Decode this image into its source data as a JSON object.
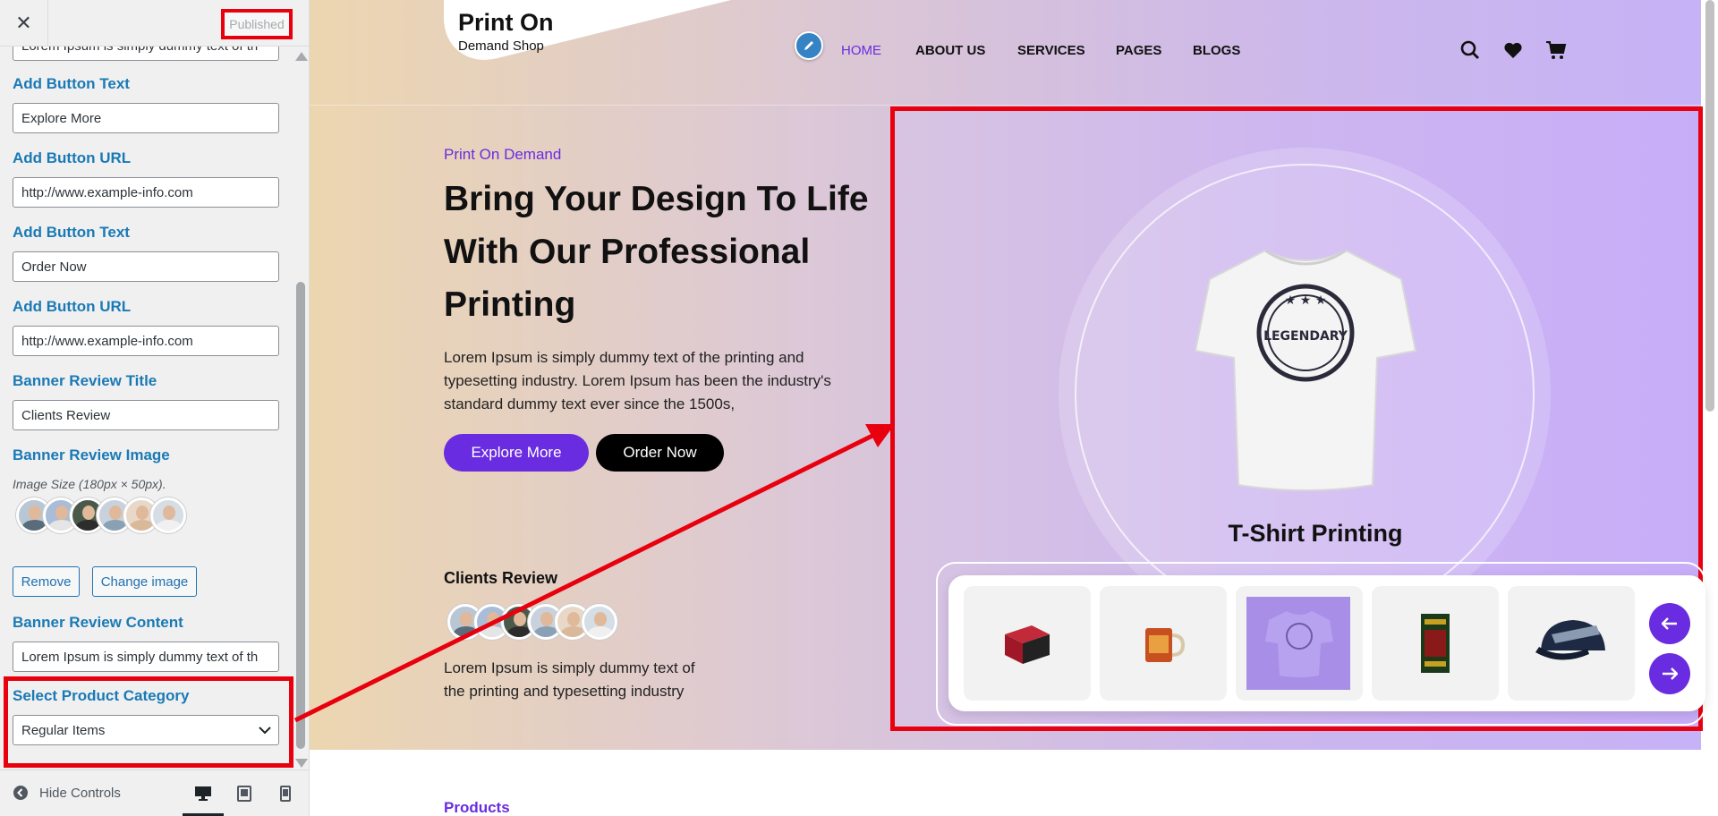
{
  "panel": {
    "close_glyph": "✕",
    "published_label": "Published",
    "top_partial_text": "Lorem Ipsum is simply dummy text of th",
    "fields": [
      {
        "label": "Add Button Text",
        "value": "Explore More"
      },
      {
        "label": "Add Button URL",
        "value": "http://www.example-info.com"
      },
      {
        "label": "Add Button Text",
        "value": "Order Now"
      },
      {
        "label": "Add Button URL",
        "value": "http://www.example-info.com"
      },
      {
        "label": "Banner Review Title",
        "value": "Clients Review"
      }
    ],
    "review_image": {
      "label": "Banner Review Image",
      "desc": "Image Size (180px × 50px).",
      "remove_label": "Remove",
      "change_label": "Change image"
    },
    "review_content": {
      "label": "Banner Review Content",
      "value": "Lorem Ipsum is simply dummy text of th"
    },
    "product_category": {
      "label": "Select Product Category",
      "value": "Regular Items"
    },
    "footer": {
      "hide_controls_label": "Hide Controls"
    }
  },
  "site": {
    "logo": {
      "title": "Print On",
      "subtitle": "Demand Shop"
    },
    "nav": [
      "HOME",
      "ABOUT US",
      "SERVICES",
      "PAGES",
      "BLOGS"
    ],
    "hero": {
      "eyebrow": "Print On Demand",
      "heading": [
        "Bring Your Design To Life",
        "With Our Professional",
        "Printing"
      ],
      "body": [
        "Lorem Ipsum is simply dummy text of the printing and",
        "typesetting industry. Lorem Ipsum has been the industry's",
        "standard dummy text ever since the 1500s,"
      ],
      "btn_primary": "Explore More",
      "btn_secondary": "Order Now",
      "review_title": "Clients Review",
      "review_text": [
        "Lorem Ipsum is simply dummy text of",
        "the printing and typesetting industry"
      ]
    },
    "feature": {
      "title": "T-Shirt Printing",
      "shirt_print": "LEGENDARY"
    },
    "products_label": "Products"
  },
  "colors": {
    "accent": "#6a2ce0",
    "highlight_red": "#e8000e",
    "panel_label": "#1a7ab5",
    "panel_bg": "#f0f0f1"
  }
}
